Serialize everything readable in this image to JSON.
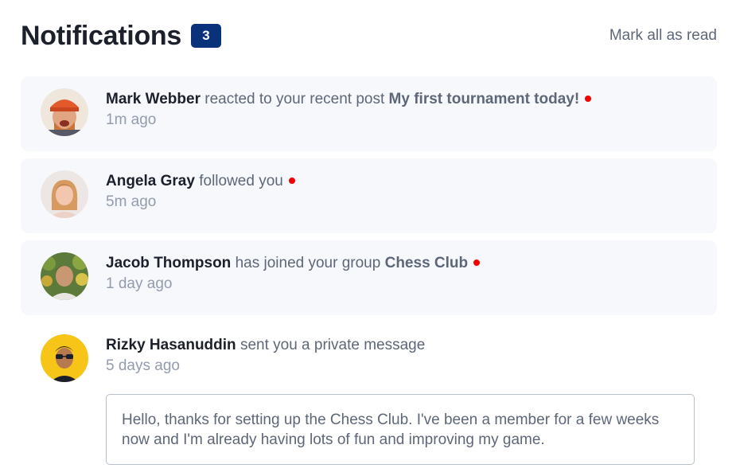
{
  "header": {
    "title": "Notifications",
    "unread_count": "3",
    "mark_all_label": "Mark all as read"
  },
  "colors": {
    "badge": "#0a327b",
    "unread_background": "#f6f8fc",
    "dot": "#f40000",
    "actor_text": "#1c202b",
    "secondary_text": "#5e6778",
    "time_text": "#939cad"
  },
  "notifications": [
    {
      "actor": "Mark Webber",
      "action": "reacted to your recent post",
      "target": "My first tournament today!",
      "time": "1m ago",
      "unread": true
    },
    {
      "actor": "Angela Gray",
      "action": "followed you",
      "target": "",
      "time": "5m ago",
      "unread": true
    },
    {
      "actor": "Jacob Thompson",
      "action": "has joined your group",
      "target": "Chess Club",
      "time": "1 day ago",
      "unread": true
    },
    {
      "actor": "Rizky Hasanuddin",
      "action": "sent you a private message",
      "target": "",
      "time": "5 days ago",
      "unread": false,
      "message": "Hello, thanks for setting up the Chess Club. I've been a member for a few weeks now and I'm already having lots of fun and improving my game."
    }
  ]
}
